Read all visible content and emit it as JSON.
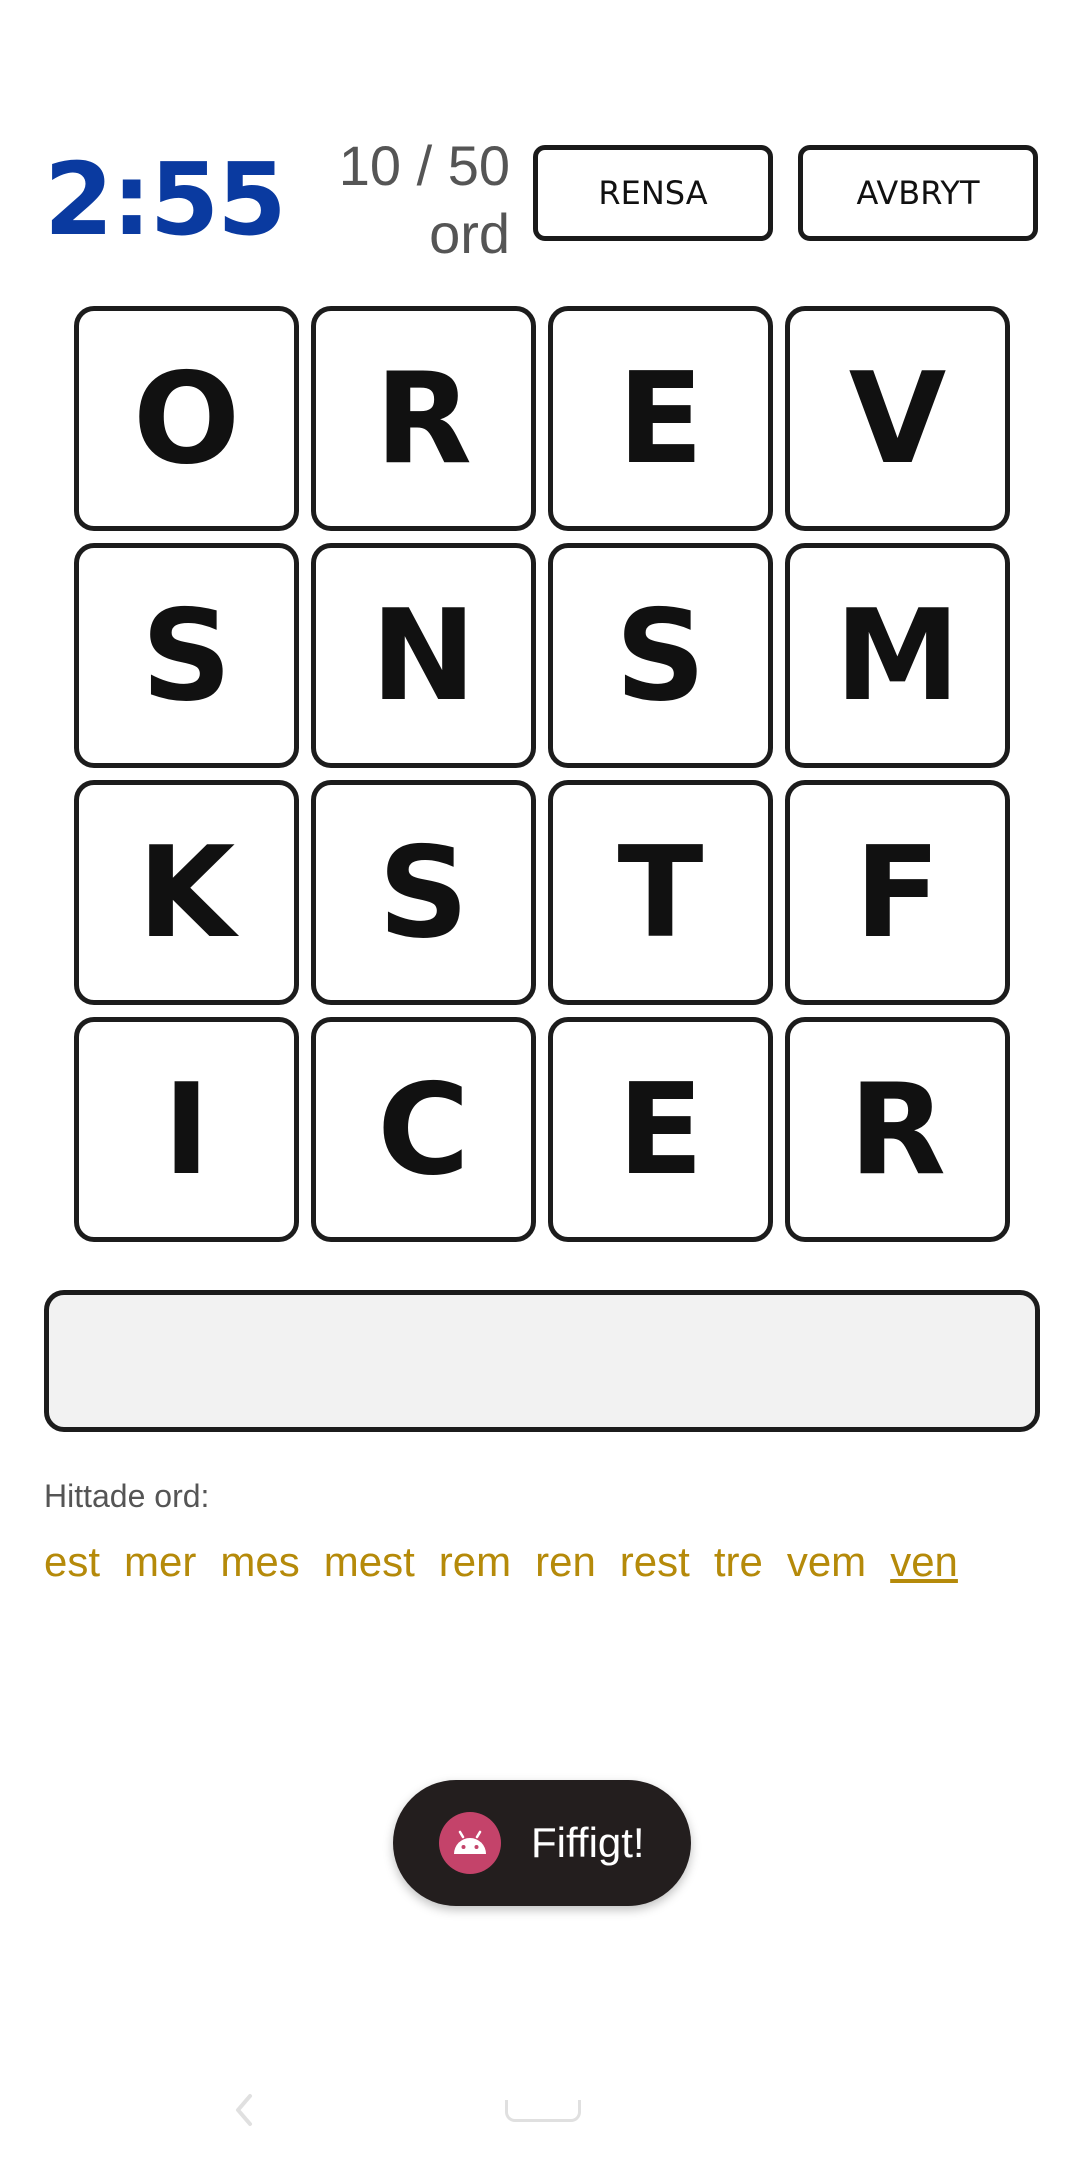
{
  "header": {
    "timer": "2:55",
    "word_count": "10 / 50 ord",
    "clear_label": "RENSA",
    "cancel_label": "AVBRYT"
  },
  "grid": {
    "rows": [
      [
        "O",
        "R",
        "E",
        "V"
      ],
      [
        "S",
        "N",
        "S",
        "M"
      ],
      [
        "K",
        "S",
        "T",
        "F"
      ],
      [
        "I",
        "C",
        "E",
        "R"
      ]
    ]
  },
  "input": {
    "value": ""
  },
  "found": {
    "label": "Hittade ord:",
    "words": [
      "est",
      "mer",
      "mes",
      "mest",
      "rem",
      "ren",
      "rest",
      "tre",
      "vem",
      "ven"
    ],
    "highlighted_index": 9,
    "color": "#b58a0a"
  },
  "toast": {
    "text": "Fiffigt!",
    "icon": "android-icon"
  },
  "colors": {
    "timer": "#0a3aa0",
    "toast_bg": "#231e1e",
    "toast_icon_bg": "#c4436a"
  }
}
